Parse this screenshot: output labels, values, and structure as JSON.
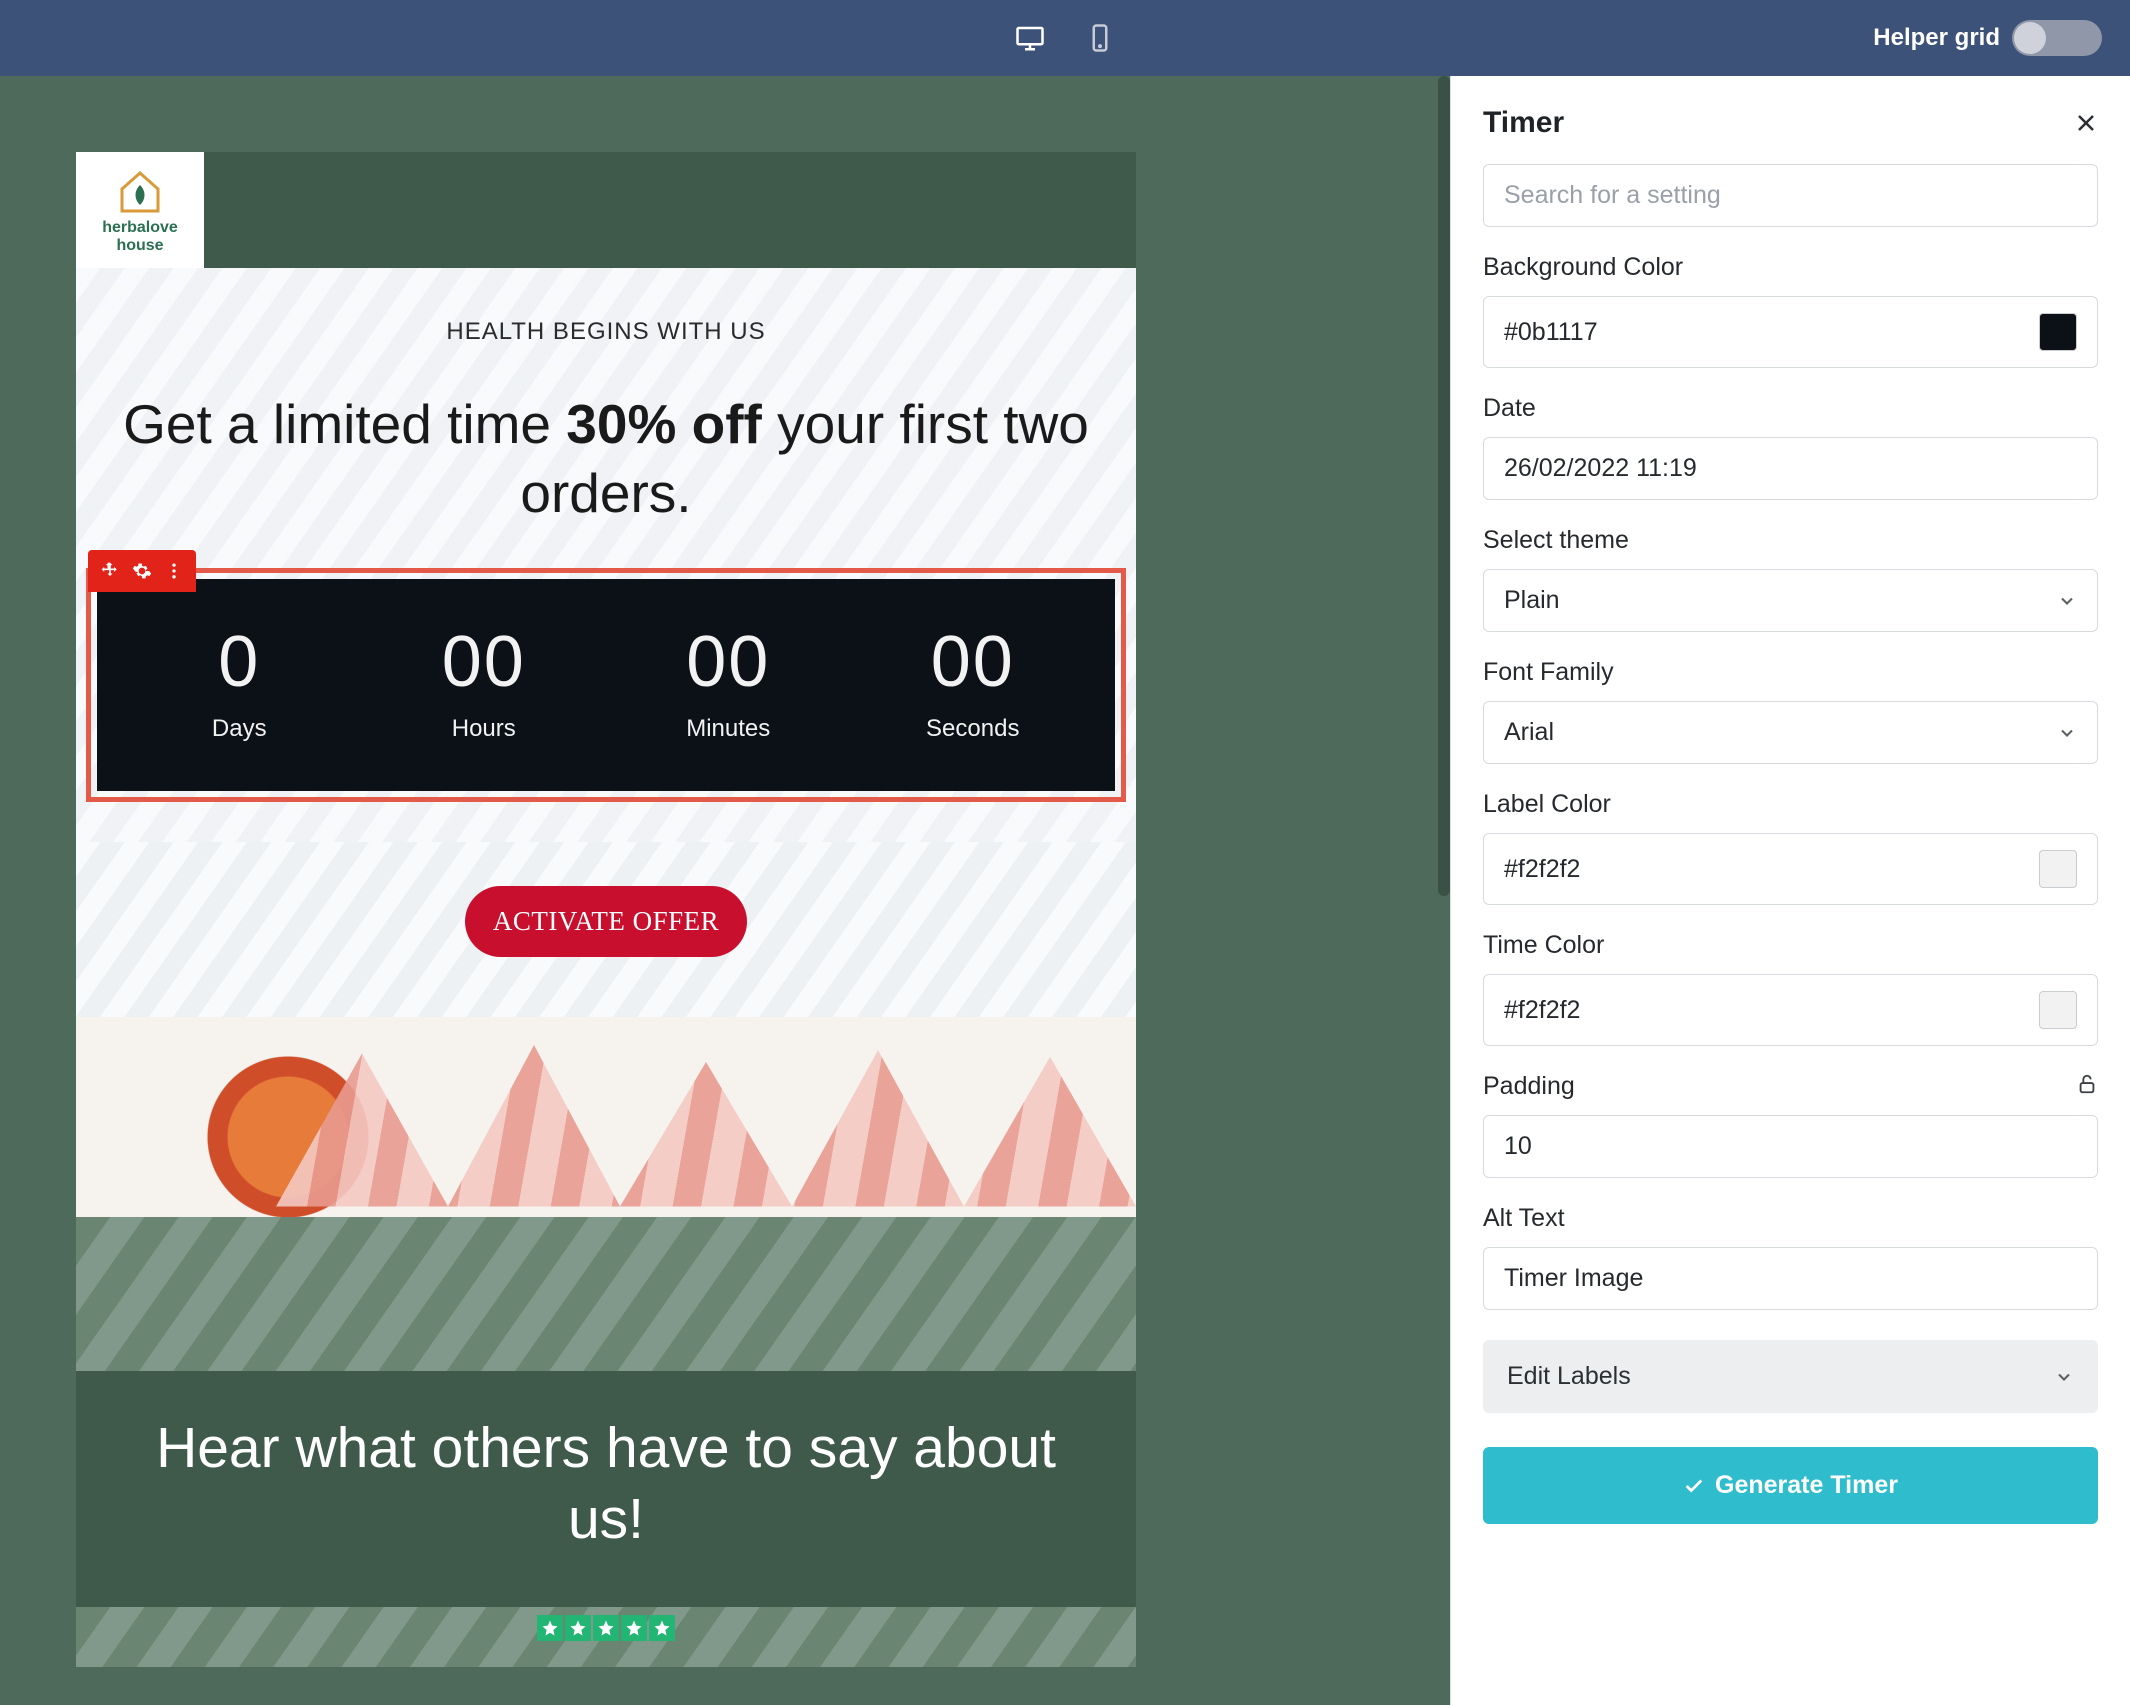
{
  "topbar": {
    "helper_grid_label": "Helper grid"
  },
  "email": {
    "logo_line1": "herbalove",
    "logo_line2": "house",
    "kicker": "HEALTH BEGINS WITH US",
    "headline_a": "Get a limited time ",
    "headline_b": "30% off",
    "headline_c": " your first two orders.",
    "cta": "ACTIVATE OFFER",
    "testimonials_heading": "Hear what others have to say about us!"
  },
  "timer": {
    "days_val": "0",
    "days_lbl": "Days",
    "hours_val": "00",
    "hours_lbl": "Hours",
    "minutes_val": "00",
    "minutes_lbl": "Minutes",
    "seconds_val": "00",
    "seconds_lbl": "Seconds"
  },
  "panel": {
    "title": "Timer",
    "search_placeholder": "Search for a setting",
    "labels": {
      "background_color": "Background Color",
      "date": "Date",
      "select_theme": "Select theme",
      "font_family": "Font Family",
      "label_color": "Label Color",
      "time_color": "Time Color",
      "padding": "Padding",
      "alt_text": "Alt Text"
    },
    "values": {
      "background_color": "#0b1117",
      "date": "26/02/2022 11:19",
      "select_theme": "Plain",
      "font_family": "Arial",
      "label_color": "#f2f2f2",
      "time_color": "#f2f2f2",
      "padding": "10",
      "alt_text": "Timer Image"
    },
    "swatches": {
      "background_color": "#0b1117",
      "label_color": "#f2f2f2",
      "time_color": "#f2f2f2"
    },
    "edit_labels": "Edit Labels",
    "generate": "Generate Timer"
  }
}
